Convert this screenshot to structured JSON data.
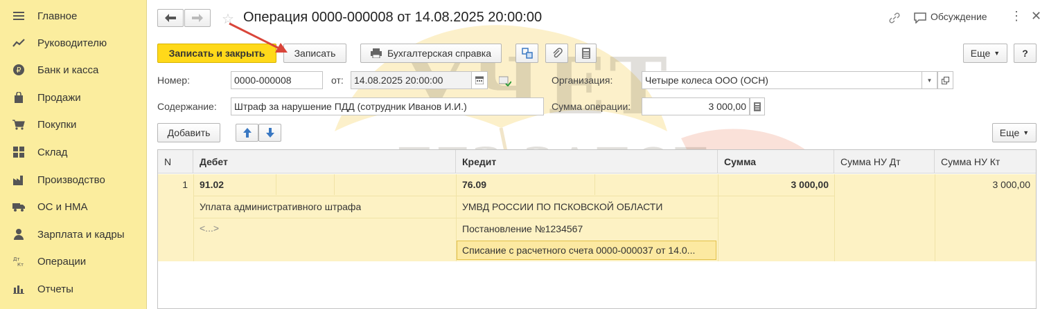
{
  "sidebar": {
    "items": [
      {
        "label": "Главное",
        "icon": "menu-icon"
      },
      {
        "label": "Руководителю",
        "icon": "trend-icon"
      },
      {
        "label": "Банк и касса",
        "icon": "ruble-icon"
      },
      {
        "label": "Продажи",
        "icon": "bag-icon"
      },
      {
        "label": "Покупки",
        "icon": "cart-icon"
      },
      {
        "label": "Склад",
        "icon": "warehouse-icon"
      },
      {
        "label": "Производство",
        "icon": "factory-icon"
      },
      {
        "label": "ОС и НМА",
        "icon": "truck-icon"
      },
      {
        "label": "Зарплата и кадры",
        "icon": "person-icon"
      },
      {
        "label": "Операции",
        "icon": "dt-kt-icon"
      },
      {
        "label": "Отчеты",
        "icon": "bar-chart-icon"
      }
    ],
    "icon_glyphs": [
      "☰",
      "↗",
      "₽",
      "▮",
      "▬",
      "▦",
      "▟",
      "▬",
      "●",
      "ᴰᵀₖₜ",
      "▮"
    ]
  },
  "header": {
    "title": "Операция 0000-000008 от 14.08.2025 20:00:00",
    "discussion": "Обсуждение"
  },
  "toolbar": {
    "save_close": "Записать и закрыть",
    "save": "Записать",
    "accounting_note": "Бухгалтерская справка",
    "more": "Еще",
    "help": "?"
  },
  "form": {
    "number_label": "Номер:",
    "number_value": "0000-000008",
    "date_label": "от:",
    "date_value": "14.08.2025 20:00:00",
    "org_label": "Организация:",
    "org_value": "Четыре колеса ООО (ОСН)",
    "content_label": "Содержание:",
    "content_value": "Штраф за нарушение ПДД (сотрудник Иванов И.И.)",
    "sum_label": "Сумма операции:",
    "sum_value": "3 000,00"
  },
  "table_toolbar": {
    "add": "Добавить",
    "more": "Еще"
  },
  "table": {
    "columns": [
      "N",
      "Дебет",
      "Кредит",
      "Сумма",
      "Сумма НУ Дт",
      "Сумма НУ Кт"
    ],
    "row": {
      "n": "1",
      "debit_account": "91.02",
      "debit_sub1": "Уплата административного штрафа",
      "debit_sub2": "<...>",
      "credit_account": "76.09",
      "credit_sub1": "УМВД РОССИИ ПО ПСКОВСКОЙ ОБЛАСТИ",
      "credit_sub2": "Постановление №1234567",
      "credit_sub3": "Списание с расчетного счета 0000-000037 от 14.0...",
      "sum": "3 000,00",
      "sum_nu_kt": "3 000,00"
    }
  },
  "watermark": {
    "line1": "УЧЕТ",
    "line2": "БЕЗ ЗАБОТ"
  },
  "colors": {
    "sidebar_bg": "#fbed9e",
    "primary_button": "#ffd91a",
    "row_highlight": "#fdf2c4",
    "annotation_arrow": "#d9453a"
  }
}
